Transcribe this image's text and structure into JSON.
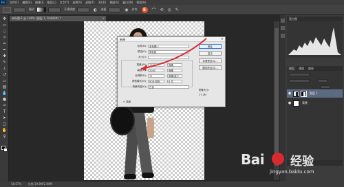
{
  "menu": {
    "logo": "Ps",
    "items": [
      "文件(F)",
      "编辑(E)",
      "图像(I)",
      "图层(L)",
      "文字(Y)",
      "选择(S)",
      "滤镜(T)",
      "3D(D)",
      "视图(V)",
      "窗口(W)",
      "帮助(H)"
    ]
  },
  "options": {
    "label1": "模式",
    "label2": "不透明度",
    "label3": "流量",
    "label4": "对齐",
    "badge": "5"
  },
  "doc_tab": {
    "label": "未标题-1 @ 100% (图层 1, RGB/8#) *",
    "close": "×"
  },
  "status": {
    "zoom": "16.67%",
    "doc": "文档:19.8M/2.80M"
  },
  "histogram": {
    "header": "直方图"
  },
  "layers": {
    "tabs": [
      "图层",
      "通道",
      "路径"
    ],
    "rows": [
      {
        "name": "图层 1",
        "eye": "●"
      },
      {
        "name": "背景",
        "eye": "●"
      }
    ]
  },
  "dialog": {
    "title": "新建",
    "close": "×",
    "name_label": "名称(N):",
    "name_value": "未标题-1",
    "preset_label": "预设(P):",
    "preset_value": "剪贴板",
    "size_label": "大小(I):",
    "width_label": "宽度(W):",
    "width_value": "1500",
    "width_unit": "像素",
    "height_label": "高度(H):",
    "height_value": "2000",
    "height_unit": "像素",
    "res_label": "分辨率(R):",
    "res_value": "72",
    "res_unit": "像素/英寸",
    "mode_label": "颜色模式(M):",
    "mode_value": "RGB 颜色",
    "mode_bits": "8 位",
    "bg_label": "背景内容(C):",
    "bg_value": "白色",
    "advanced": "高级",
    "btn_ok": "确定",
    "btn_cancel": "复位",
    "btn_save": "存储预设(S)...",
    "btn_delete": "删除预设(D)...",
    "size_caption": "图像大小:",
    "size_value": "17.2M"
  },
  "watermark": {
    "brand_left": "Bai",
    "brand_right": "经验",
    "url": "jingyan.baidu.com"
  },
  "colors": {
    "accent_red": "#d8292f",
    "selected_layer": "#5a6b82"
  }
}
